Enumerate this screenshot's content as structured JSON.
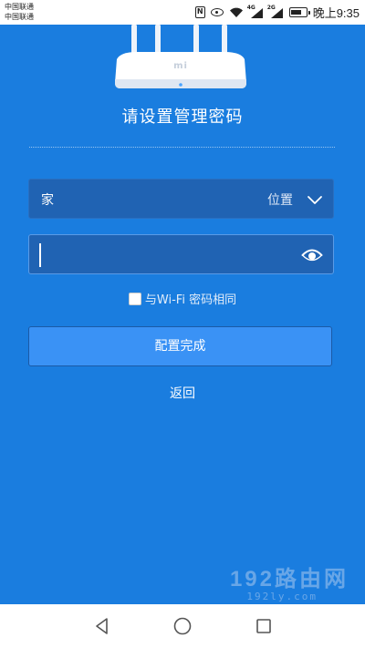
{
  "status_bar": {
    "carrier_1": "中国联通",
    "carrier_2": "中国联通",
    "net_1": "4G",
    "net_2": "2G",
    "time": "晚上9:35"
  },
  "router_brand": "mi",
  "page_title": "请设置管理密码",
  "location": {
    "value": "家",
    "label": "位置"
  },
  "password": {
    "value": "",
    "placeholder": ""
  },
  "same_as_wifi": {
    "checked": false,
    "label": "与Wi-Fi 密码相同"
  },
  "primary_button_label": "配置完成",
  "back_label": "返回",
  "watermark": {
    "main": "192路由网",
    "sub": "192ly.com"
  },
  "colors": {
    "background": "#1a7ddf",
    "field_bg": "#2063b3",
    "button_bg": "#3a92f5"
  }
}
